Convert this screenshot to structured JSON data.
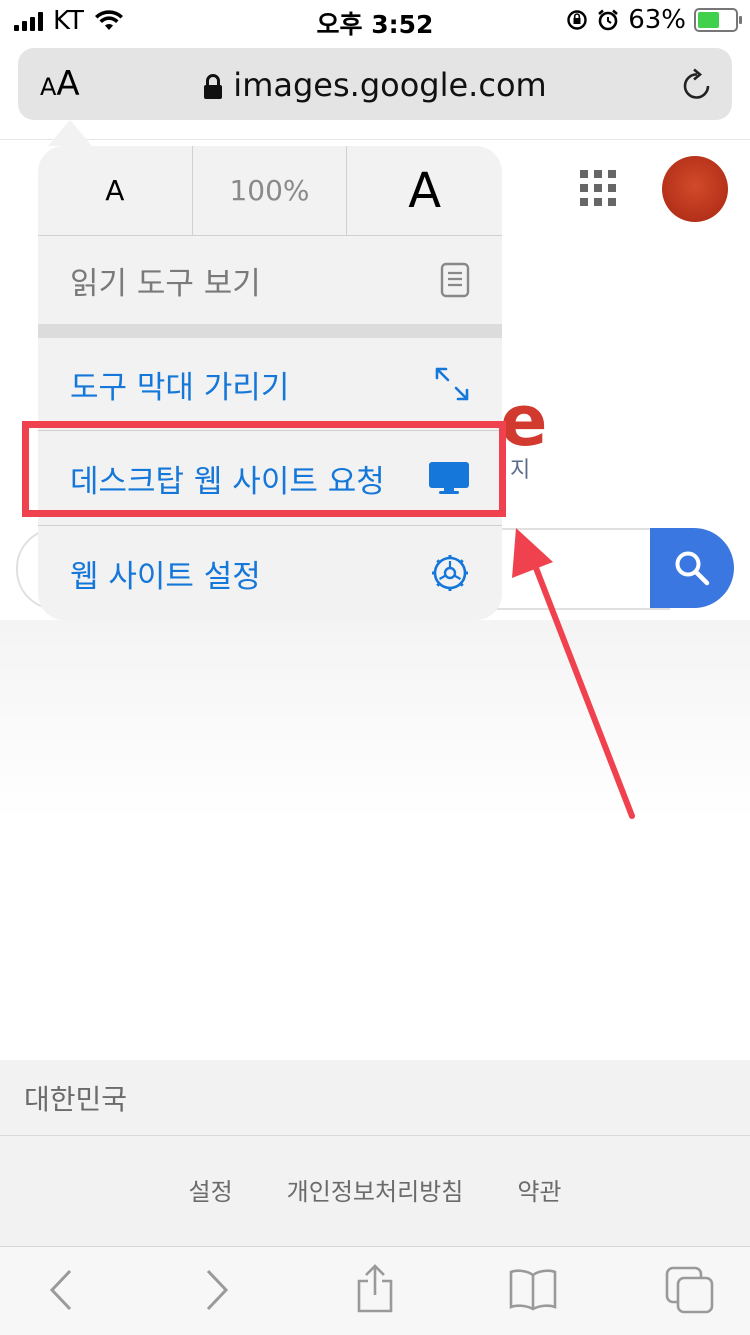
{
  "status": {
    "carrier": "KT",
    "time": "오후 3:52",
    "battery": "63%",
    "battery_level": 0.63,
    "charging_color": "#3fd04c"
  },
  "urlbar": {
    "aa_small": "A",
    "aa_big": "A",
    "url": "images.google.com",
    "lock_icon": "lock-icon",
    "reload_icon": "reload-icon"
  },
  "menu": {
    "font_small": "A",
    "zoom": "100%",
    "font_big": "A",
    "reader": "읽기 도구 보기",
    "hide_toolbar": "도구 막대 가리기",
    "request_desktop": "데스크탑 웹 사이트 요청",
    "site_settings": "웹 사이트 설정"
  },
  "page": {
    "logo_fragment": "e",
    "logo_sub": "지"
  },
  "footer": {
    "country": "대한민국",
    "links": [
      "설정",
      "개인정보처리방침",
      "약관"
    ]
  },
  "colors": {
    "accent": "#1477d9",
    "highlight": "#f0424e",
    "search_button": "#3b77e0"
  }
}
